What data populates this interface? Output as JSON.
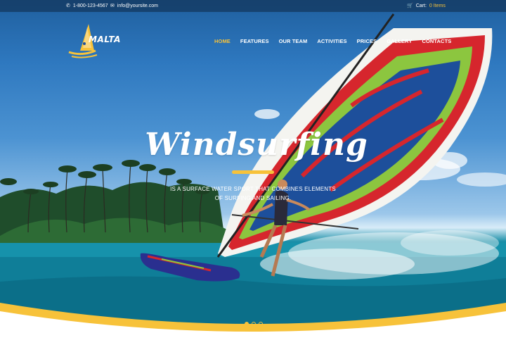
{
  "topbar": {
    "phone": "1-800-123-4567",
    "email": "info@yoursite.com",
    "cart_label": "Cart:",
    "cart_count": "0 Items"
  },
  "logo": {
    "text": "MALTA"
  },
  "nav": {
    "items": [
      {
        "label": "HOME",
        "active": true
      },
      {
        "label": "FEATURES"
      },
      {
        "label": "OUR TEAM"
      },
      {
        "label": "ACTIVITIES"
      },
      {
        "label": "PRICES"
      },
      {
        "label": "GALLERY"
      },
      {
        "label": "CONTACTS"
      }
    ]
  },
  "hero": {
    "headline": "Windsurfing",
    "subline_1": "IS A SURFACE WATER SPORT THAT COMBINES ELEMENTS",
    "subline_2": "OF SURFING AND SAILING.",
    "slides": 3,
    "active_slide": 1
  },
  "colors": {
    "accent": "#f7c23a",
    "sky": "#2e78bf",
    "sea": "#0e7a93",
    "sail_red": "#d6262d",
    "sail_green": "#8cc63f",
    "sail_blue": "#1d4f9b"
  }
}
